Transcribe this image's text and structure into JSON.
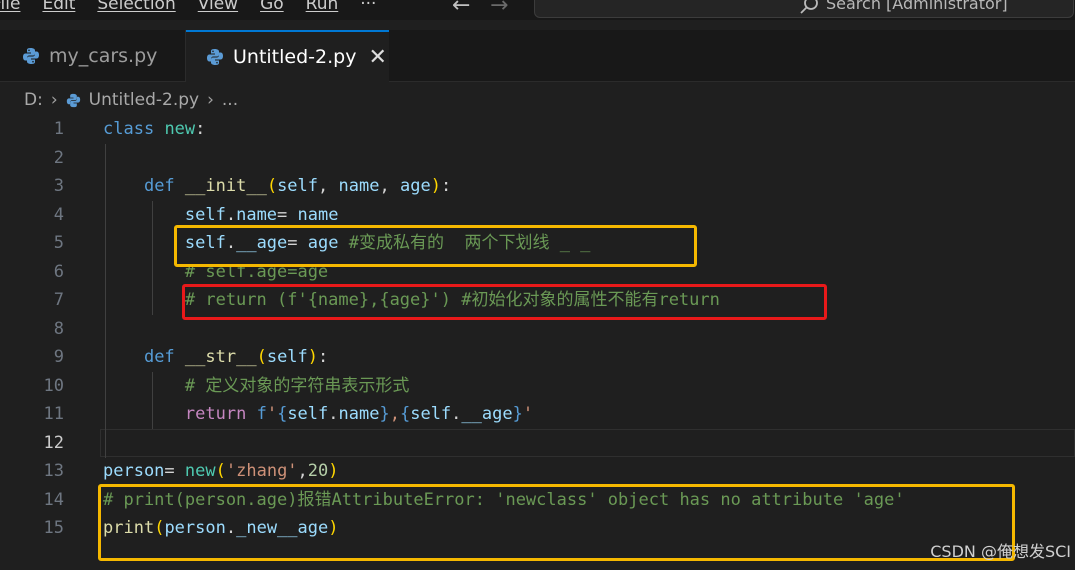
{
  "menu": [
    "File",
    "Edit",
    "Selection",
    "View",
    "Go",
    "Run",
    "···"
  ],
  "search": {
    "label": "Search [Administrator]"
  },
  "tabs": [
    {
      "label": "my_cars.py",
      "active": false,
      "icon": "python-icon"
    },
    {
      "label": "Untitled-2.py",
      "active": true,
      "icon": "python-icon",
      "close": "✕"
    }
  ],
  "breadcrumb": {
    "drive": "D:",
    "file": "Untitled-2.py",
    "more": "..."
  },
  "editor": {
    "active_line": 12,
    "lines": [
      {
        "n": "1",
        "text": "class new:"
      },
      {
        "n": "2",
        "text": ""
      },
      {
        "n": "3",
        "text": "    def __init__(self, name, age):"
      },
      {
        "n": "4",
        "text": "        self.name= name"
      },
      {
        "n": "5",
        "text": "        self.__age= age #变成私有的  两个下划线 _ _"
      },
      {
        "n": "6",
        "text": "        # self.age=age"
      },
      {
        "n": "7",
        "text": "        # return (f'{name},{age}') #初始化对象的属性不能有return"
      },
      {
        "n": "8",
        "text": ""
      },
      {
        "n": "9",
        "text": "    def __str__(self):"
      },
      {
        "n": "10",
        "text": "        # 定义对象的字符串表示形式"
      },
      {
        "n": "11",
        "text": "        return f'{self.name},{self.__age}'"
      },
      {
        "n": "12",
        "text": ""
      },
      {
        "n": "13",
        "text": "person= new('zhang',20)"
      },
      {
        "n": "14",
        "text": "# print(person.age)报错AttributeError: 'newclass' object has no attribute 'age'"
      },
      {
        "n": "15",
        "text": "print(person._new__age)"
      }
    ]
  },
  "annotations": [
    {
      "type": "highlight-box",
      "color": "#f5b800",
      "lines": [
        5
      ]
    },
    {
      "type": "highlight-box",
      "color": "#e8191a",
      "lines": [
        7
      ]
    },
    {
      "type": "highlight-box",
      "color": "#f5b800",
      "lines": [
        14,
        15
      ]
    }
  ],
  "watermark": "CSDN @俺想发SCI",
  "colors": {
    "editor_bg": "#1f1f1f",
    "keyword": "#569cd6",
    "function": "#dcdcaa",
    "class": "#4ec9b0",
    "variable": "#9cdcfe",
    "string": "#ce9178",
    "number": "#b5cea8",
    "comment": "#6a9955",
    "tab_accent": "#0078d4"
  }
}
